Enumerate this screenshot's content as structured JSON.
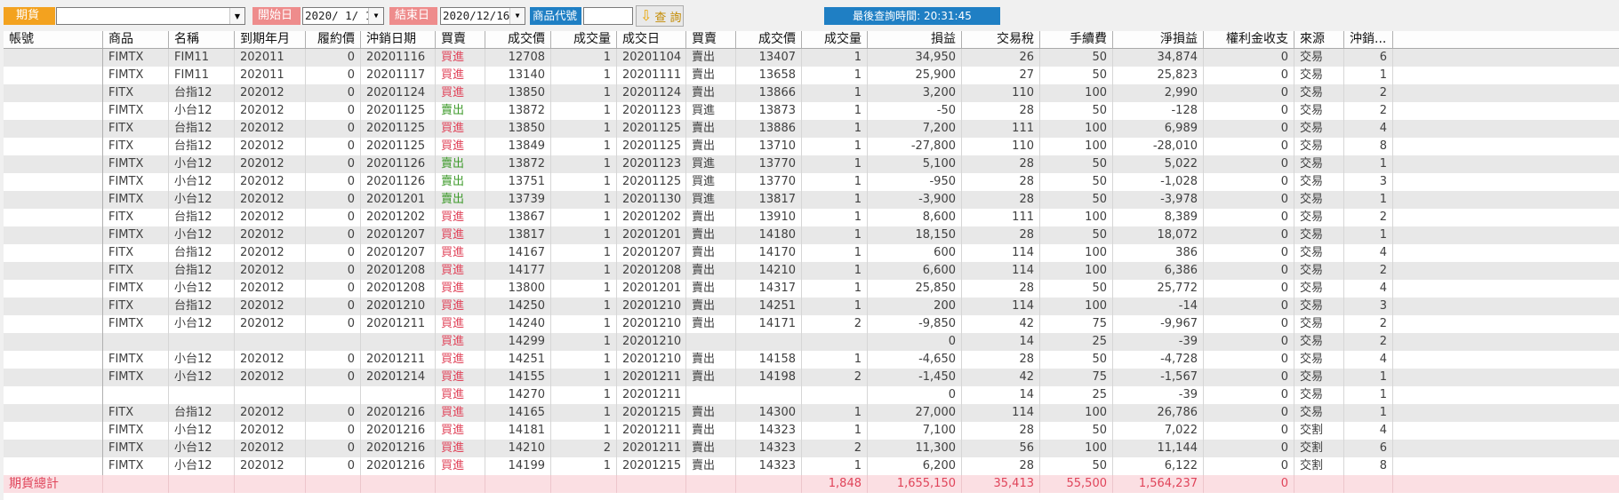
{
  "toolbar": {
    "market": "期貨",
    "product_combo_value": "",
    "start_label": "開始日",
    "start_date": "2020/ 1/ 1",
    "end_label": "結束日",
    "end_date": "2020/12/16",
    "code_label": "商品代號",
    "code_value": "",
    "query_label": "查 詢",
    "last_query": "最後查詢時間: 20:31:45",
    "colors": {
      "market": "#f3a21f",
      "date_label": "#ee8c8c",
      "blue": "#1f7fc4"
    }
  },
  "columns": [
    "帳號",
    "商品",
    "名稱",
    "到期年月",
    "履約價",
    "沖銷日期",
    "買賣",
    "成交價",
    "成交量",
    "成交日",
    "買賣",
    "成交價",
    "成交量",
    "損益",
    "交易稅",
    "手續費",
    "淨損益",
    "權利金收支",
    "來源",
    "沖銷..."
  ],
  "rows": [
    {
      "prod": "FIMTX",
      "name": "FIM11",
      "exp": "202011",
      "strike": "0",
      "cdate": "20201116",
      "side": "買進",
      "price": "12708",
      "qty": "1",
      "tdate": "20201104",
      "tside": "賣出",
      "tprice": "13407",
      "tqty": "1",
      "pl": "34,950",
      "tax": "26",
      "fee": "50",
      "net": "34,874",
      "prem": "0",
      "src": "交易",
      "n": "6"
    },
    {
      "prod": "FIMTX",
      "name": "FIM11",
      "exp": "202011",
      "strike": "0",
      "cdate": "20201117",
      "side": "買進",
      "price": "13140",
      "qty": "1",
      "tdate": "20201111",
      "tside": "賣出",
      "tprice": "13658",
      "tqty": "1",
      "pl": "25,900",
      "tax": "27",
      "fee": "50",
      "net": "25,823",
      "prem": "0",
      "src": "交易",
      "n": "1"
    },
    {
      "prod": "FITX",
      "name": "台指12",
      "exp": "202012",
      "strike": "0",
      "cdate": "20201124",
      "side": "買進",
      "price": "13850",
      "qty": "1",
      "tdate": "20201124",
      "tside": "賣出",
      "tprice": "13866",
      "tqty": "1",
      "pl": "3,200",
      "tax": "110",
      "fee": "100",
      "net": "2,990",
      "prem": "0",
      "src": "交易",
      "n": "2"
    },
    {
      "prod": "FIMTX",
      "name": "小台12",
      "exp": "202012",
      "strike": "0",
      "cdate": "20201125",
      "side": "賣出",
      "price": "13872",
      "qty": "1",
      "tdate": "20201123",
      "tside": "買進",
      "tprice": "13873",
      "tqty": "1",
      "pl": "-50",
      "tax": "28",
      "fee": "50",
      "net": "-128",
      "prem": "0",
      "src": "交易",
      "n": "2"
    },
    {
      "prod": "FITX",
      "name": "台指12",
      "exp": "202012",
      "strike": "0",
      "cdate": "20201125",
      "side": "買進",
      "price": "13850",
      "qty": "1",
      "tdate": "20201125",
      "tside": "賣出",
      "tprice": "13886",
      "tqty": "1",
      "pl": "7,200",
      "tax": "111",
      "fee": "100",
      "net": "6,989",
      "prem": "0",
      "src": "交易",
      "n": "4"
    },
    {
      "prod": "FITX",
      "name": "台指12",
      "exp": "202012",
      "strike": "0",
      "cdate": "20201125",
      "side": "買進",
      "price": "13849",
      "qty": "1",
      "tdate": "20201125",
      "tside": "賣出",
      "tprice": "13710",
      "tqty": "1",
      "pl": "-27,800",
      "tax": "110",
      "fee": "100",
      "net": "-28,010",
      "prem": "0",
      "src": "交易",
      "n": "8"
    },
    {
      "prod": "FIMTX",
      "name": "小台12",
      "exp": "202012",
      "strike": "0",
      "cdate": "20201126",
      "side": "賣出",
      "price": "13872",
      "qty": "1",
      "tdate": "20201123",
      "tside": "買進",
      "tprice": "13770",
      "tqty": "1",
      "pl": "5,100",
      "tax": "28",
      "fee": "50",
      "net": "5,022",
      "prem": "0",
      "src": "交易",
      "n": "1"
    },
    {
      "prod": "FIMTX",
      "name": "小台12",
      "exp": "202012",
      "strike": "0",
      "cdate": "20201126",
      "side": "賣出",
      "price": "13751",
      "qty": "1",
      "tdate": "20201125",
      "tside": "買進",
      "tprice": "13770",
      "tqty": "1",
      "pl": "-950",
      "tax": "28",
      "fee": "50",
      "net": "-1,028",
      "prem": "0",
      "src": "交易",
      "n": "3"
    },
    {
      "prod": "FIMTX",
      "name": "小台12",
      "exp": "202012",
      "strike": "0",
      "cdate": "20201201",
      "side": "賣出",
      "price": "13739",
      "qty": "1",
      "tdate": "20201130",
      "tside": "買進",
      "tprice": "13817",
      "tqty": "1",
      "pl": "-3,900",
      "tax": "28",
      "fee": "50",
      "net": "-3,978",
      "prem": "0",
      "src": "交易",
      "n": "1"
    },
    {
      "prod": "FITX",
      "name": "台指12",
      "exp": "202012",
      "strike": "0",
      "cdate": "20201202",
      "side": "買進",
      "price": "13867",
      "qty": "1",
      "tdate": "20201202",
      "tside": "賣出",
      "tprice": "13910",
      "tqty": "1",
      "pl": "8,600",
      "tax": "111",
      "fee": "100",
      "net": "8,389",
      "prem": "0",
      "src": "交易",
      "n": "2"
    },
    {
      "prod": "FIMTX",
      "name": "小台12",
      "exp": "202012",
      "strike": "0",
      "cdate": "20201207",
      "side": "買進",
      "price": "13817",
      "qty": "1",
      "tdate": "20201201",
      "tside": "賣出",
      "tprice": "14180",
      "tqty": "1",
      "pl": "18,150",
      "tax": "28",
      "fee": "50",
      "net": "18,072",
      "prem": "0",
      "src": "交易",
      "n": "1"
    },
    {
      "prod": "FITX",
      "name": "台指12",
      "exp": "202012",
      "strike": "0",
      "cdate": "20201207",
      "side": "買進",
      "price": "14167",
      "qty": "1",
      "tdate": "20201207",
      "tside": "賣出",
      "tprice": "14170",
      "tqty": "1",
      "pl": "600",
      "tax": "114",
      "fee": "100",
      "net": "386",
      "prem": "0",
      "src": "交易",
      "n": "4"
    },
    {
      "prod": "FITX",
      "name": "台指12",
      "exp": "202012",
      "strike": "0",
      "cdate": "20201208",
      "side": "買進",
      "price": "14177",
      "qty": "1",
      "tdate": "20201208",
      "tside": "賣出",
      "tprice": "14210",
      "tqty": "1",
      "pl": "6,600",
      "tax": "114",
      "fee": "100",
      "net": "6,386",
      "prem": "0",
      "src": "交易",
      "n": "2"
    },
    {
      "prod": "FIMTX",
      "name": "小台12",
      "exp": "202012",
      "strike": "0",
      "cdate": "20201208",
      "side": "買進",
      "price": "13800",
      "qty": "1",
      "tdate": "20201201",
      "tside": "賣出",
      "tprice": "14317",
      "tqty": "1",
      "pl": "25,850",
      "tax": "28",
      "fee": "50",
      "net": "25,772",
      "prem": "0",
      "src": "交易",
      "n": "4"
    },
    {
      "prod": "FITX",
      "name": "台指12",
      "exp": "202012",
      "strike": "0",
      "cdate": "20201210",
      "side": "買進",
      "price": "14250",
      "qty": "1",
      "tdate": "20201210",
      "tside": "賣出",
      "tprice": "14251",
      "tqty": "1",
      "pl": "200",
      "tax": "114",
      "fee": "100",
      "net": "-14",
      "prem": "0",
      "src": "交易",
      "n": "3"
    },
    {
      "prod": "FIMTX",
      "name": "小台12",
      "exp": "202012",
      "strike": "0",
      "cdate": "20201211",
      "side": "買進",
      "price": "14240",
      "qty": "1",
      "tdate": "20201210",
      "tside": "賣出",
      "tprice": "14171",
      "tqty": "2",
      "pl": "-9,850",
      "tax": "42",
      "fee": "75",
      "net": "-9,967",
      "prem": "0",
      "src": "交易",
      "n": "2"
    },
    {
      "prod": "",
      "name": "",
      "exp": "",
      "strike": "",
      "cdate": "",
      "side": "買進",
      "price": "14299",
      "qty": "1",
      "tdate": "20201210",
      "tside": "",
      "tprice": "",
      "tqty": "",
      "pl": "0",
      "tax": "14",
      "fee": "25",
      "net": "-39",
      "prem": "0",
      "src": "交易",
      "n": "2"
    },
    {
      "prod": "FIMTX",
      "name": "小台12",
      "exp": "202012",
      "strike": "0",
      "cdate": "20201211",
      "side": "買進",
      "price": "14251",
      "qty": "1",
      "tdate": "20201210",
      "tside": "賣出",
      "tprice": "14158",
      "tqty": "1",
      "pl": "-4,650",
      "tax": "28",
      "fee": "50",
      "net": "-4,728",
      "prem": "0",
      "src": "交易",
      "n": "4"
    },
    {
      "prod": "FIMTX",
      "name": "小台12",
      "exp": "202012",
      "strike": "0",
      "cdate": "20201214",
      "side": "買進",
      "price": "14155",
      "qty": "1",
      "tdate": "20201211",
      "tside": "賣出",
      "tprice": "14198",
      "tqty": "2",
      "pl": "-1,450",
      "tax": "42",
      "fee": "75",
      "net": "-1,567",
      "prem": "0",
      "src": "交易",
      "n": "1"
    },
    {
      "prod": "",
      "name": "",
      "exp": "",
      "strike": "",
      "cdate": "",
      "side": "買進",
      "price": "14270",
      "qty": "1",
      "tdate": "20201211",
      "tside": "",
      "tprice": "",
      "tqty": "",
      "pl": "0",
      "tax": "14",
      "fee": "25",
      "net": "-39",
      "prem": "0",
      "src": "交易",
      "n": "1"
    },
    {
      "prod": "FITX",
      "name": "台指12",
      "exp": "202012",
      "strike": "0",
      "cdate": "20201216",
      "side": "買進",
      "price": "14165",
      "qty": "1",
      "tdate": "20201215",
      "tside": "賣出",
      "tprice": "14300",
      "tqty": "1",
      "pl": "27,000",
      "tax": "114",
      "fee": "100",
      "net": "26,786",
      "prem": "0",
      "src": "交易",
      "n": "1"
    },
    {
      "prod": "FIMTX",
      "name": "小台12",
      "exp": "202012",
      "strike": "0",
      "cdate": "20201216",
      "side": "買進",
      "price": "14181",
      "qty": "1",
      "tdate": "20201211",
      "tside": "賣出",
      "tprice": "14323",
      "tqty": "1",
      "pl": "7,100",
      "tax": "28",
      "fee": "50",
      "net": "7,022",
      "prem": "0",
      "src": "交割",
      "n": "4"
    },
    {
      "prod": "FIMTX",
      "name": "小台12",
      "exp": "202012",
      "strike": "0",
      "cdate": "20201216",
      "side": "買進",
      "price": "14210",
      "qty": "2",
      "tdate": "20201211",
      "tside": "賣出",
      "tprice": "14323",
      "tqty": "2",
      "pl": "11,300",
      "tax": "56",
      "fee": "100",
      "net": "11,144",
      "prem": "0",
      "src": "交割",
      "n": "6"
    },
    {
      "prod": "FIMTX",
      "name": "小台12",
      "exp": "202012",
      "strike": "0",
      "cdate": "20201216",
      "side": "買進",
      "price": "14199",
      "qty": "1",
      "tdate": "20201215",
      "tside": "賣出",
      "tprice": "14323",
      "tqty": "1",
      "pl": "6,200",
      "tax": "28",
      "fee": "50",
      "net": "6,122",
      "prem": "0",
      "src": "交割",
      "n": "8"
    }
  ],
  "total": {
    "label": "期貨總計",
    "tqty": "1,848",
    "pl": "1,655,150",
    "tax": "35,413",
    "fee": "55,500",
    "net": "1,564,237",
    "prem": "0"
  },
  "colors": {
    "buy": "#e0445a",
    "sell": "#3d9a2a",
    "alt_row": "#e8e8e8",
    "total_row": "#fbdfe3"
  }
}
